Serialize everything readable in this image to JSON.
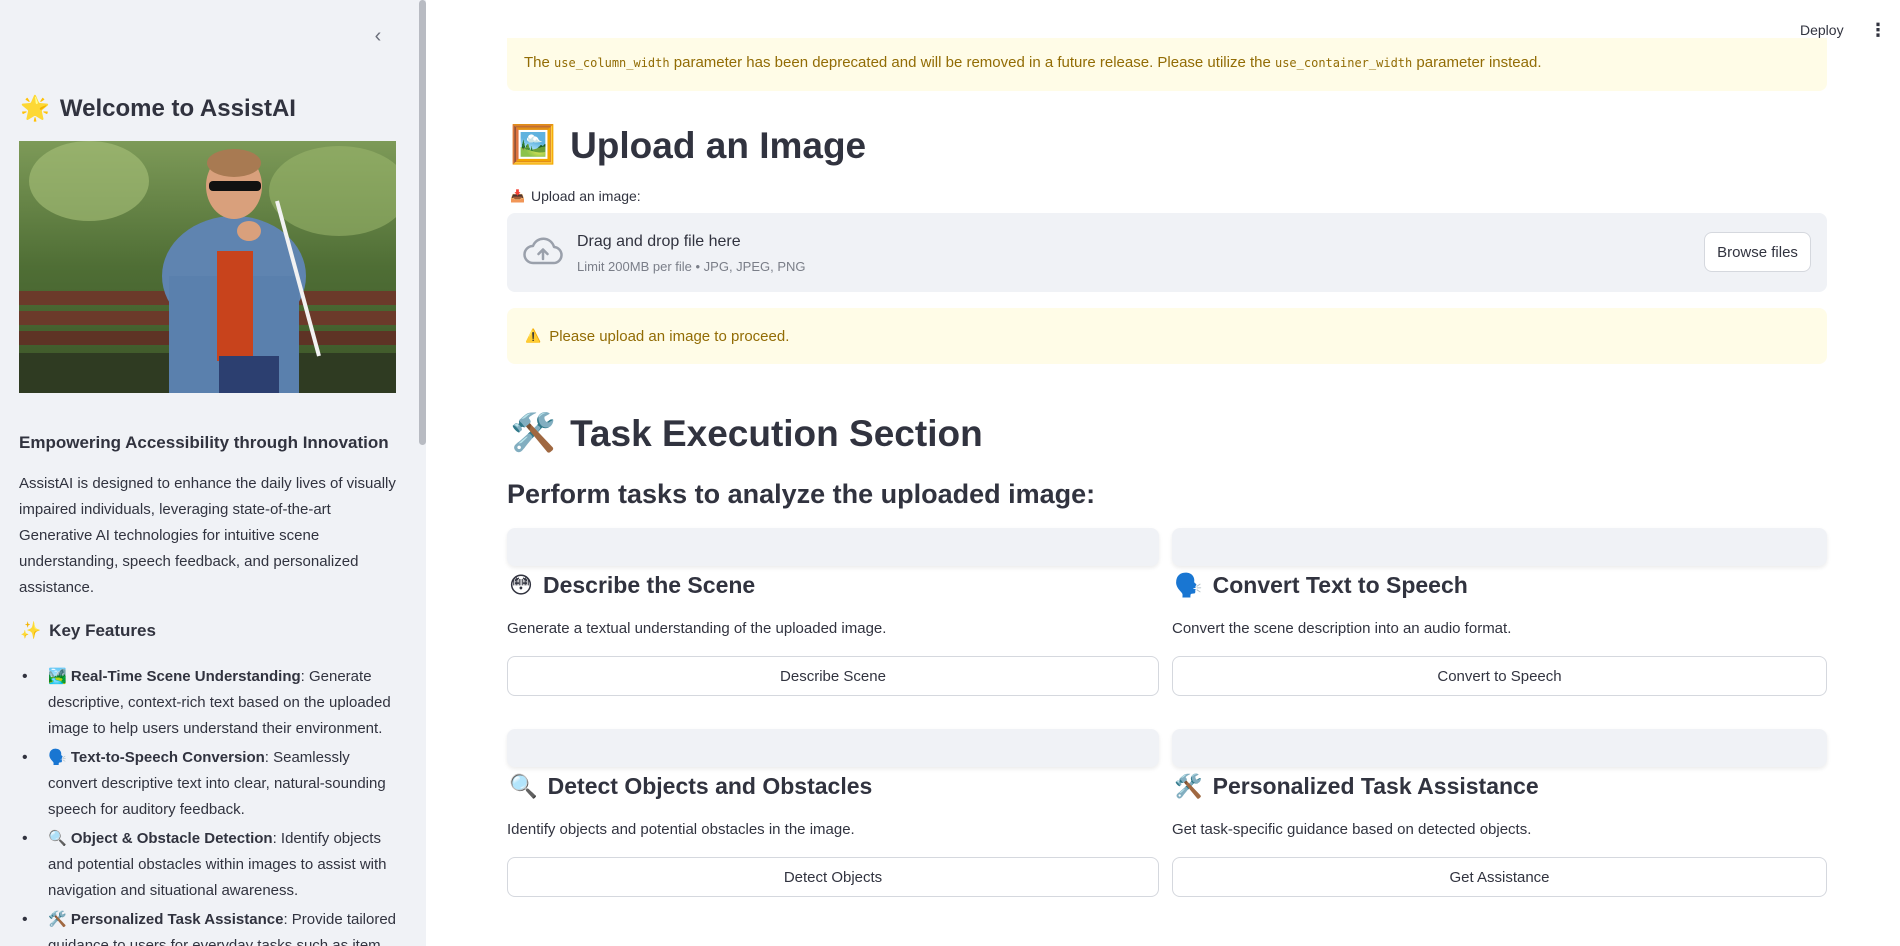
{
  "sidebar": {
    "collapse_icon": "‹",
    "title_emoji": "🌟",
    "title": "Welcome to AssistAI",
    "subtitle": "Empowering Accessibility through Innovation",
    "description": "AssistAI is designed to enhance the daily lives of visually impaired individuals, leveraging state-of-the-art Generative AI technologies for intuitive scene understanding, speech feedback, and personalized assistance.",
    "features_emoji": "✨",
    "features_heading": "Key Features",
    "features": [
      {
        "emoji": "🏞️",
        "name": "Real-Time Scene Understanding",
        "desc": ": Generate descriptive, context-rich text based on the uploaded image to help users understand their environment."
      },
      {
        "emoji": "🗣️",
        "name": "Text-to-Speech Conversion",
        "desc": ": Seamlessly convert descriptive text into clear, natural-sounding speech for auditory feedback."
      },
      {
        "emoji": "🔍",
        "name": "Object & Obstacle Detection",
        "desc": ": Identify objects and potential obstacles within images to assist with navigation and situational awareness."
      },
      {
        "emoji": "🛠️",
        "name": "Personalized Task Assistance",
        "desc": ": Provide tailored guidance to users for everyday tasks such as item"
      }
    ]
  },
  "header": {
    "deploy_label": "Deploy",
    "menu_icon": "⋮"
  },
  "deprecation_warning": {
    "prefix": "The ",
    "code1": "use_column_width",
    "middle": " parameter has been deprecated and will be removed in a future release. Please utilize the ",
    "code2": "use_container_width",
    "suffix": " parameter instead."
  },
  "upload_section": {
    "emoji": "🖼️",
    "title": "Upload an Image",
    "label_emoji": "📥",
    "label": "Upload an image:",
    "drop_text": "Drag and drop file here",
    "limit_text": "Limit 200MB per file • JPG, JPEG, PNG",
    "browse_label": "Browse files"
  },
  "upload_warning": {
    "icon": "⚠️",
    "text": "Please upload an image to proceed."
  },
  "task_section": {
    "emoji": "🛠️",
    "title": "Task Execution Section",
    "subtitle": "Perform tasks to analyze the uploaded image:",
    "cards": [
      {
        "emoji": "😳",
        "title": "Describe the Scene",
        "desc": "Generate a textual understanding of the uploaded image.",
        "button": "Describe Scene"
      },
      {
        "emoji": "🗣️",
        "title": "Convert Text to Speech",
        "desc": "Convert the scene description into an audio format.",
        "button": "Convert to Speech"
      },
      {
        "emoji": "🔍",
        "title": "Detect Objects and Obstacles",
        "desc": "Identify objects and potential obstacles in the image.",
        "button": "Detect Objects"
      },
      {
        "emoji": "🛠️",
        "title": "Personalized Task Assistance",
        "desc": "Get task-specific guidance based on detected objects.",
        "button": "Get Assistance"
      }
    ]
  }
}
